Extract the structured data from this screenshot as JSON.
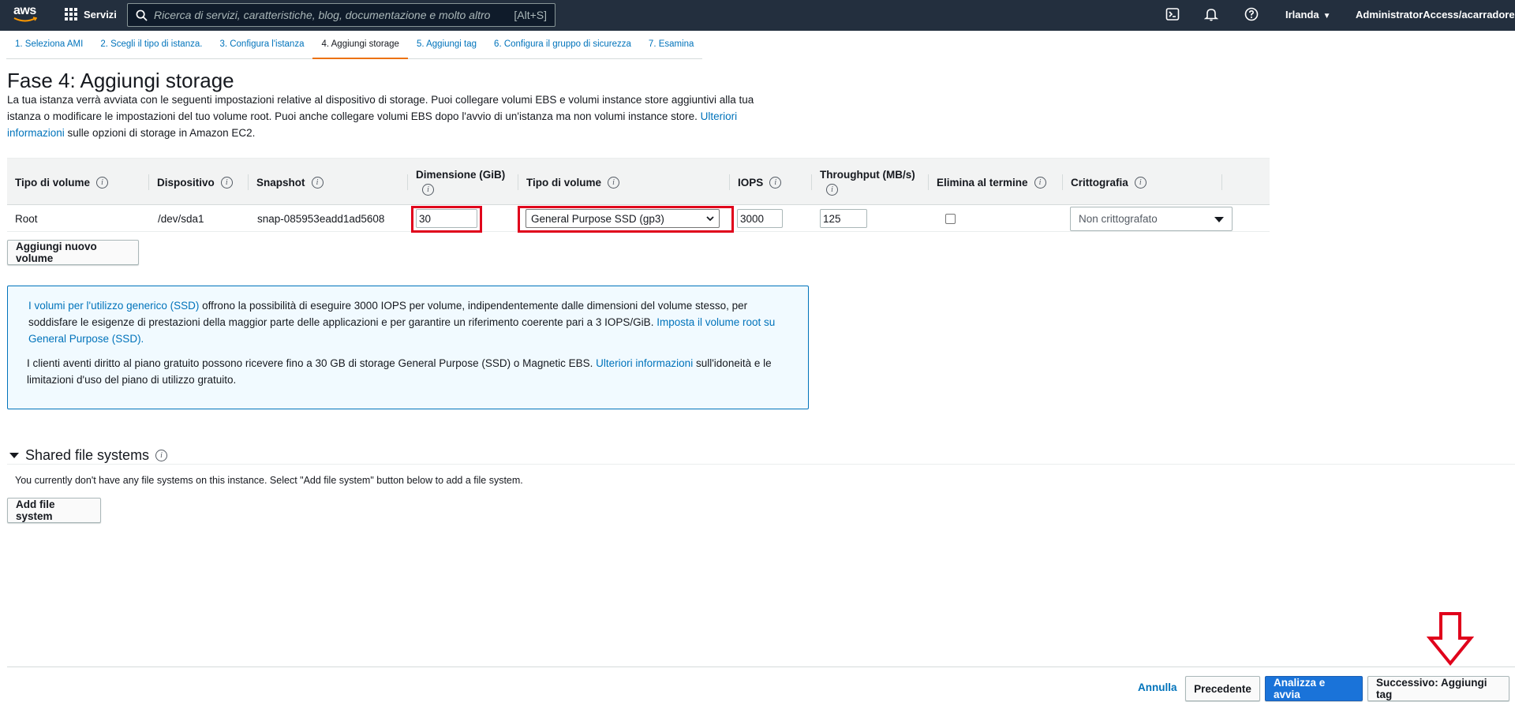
{
  "nav": {
    "logo": "aws",
    "services_label": "Servizi",
    "search_placeholder": "Ricerca di servizi, caratteristiche, blog, documentazione e molto altro",
    "search_shortcut": "[Alt+S]",
    "region": "Irlanda",
    "account": "AdministratorAccess/acarradore",
    "icons": [
      "cloudshell-icon",
      "bell-icon",
      "help-icon"
    ]
  },
  "steps": [
    {
      "label": "1. Seleziona AMI",
      "active": false
    },
    {
      "label": "2. Scegli il tipo di istanza.",
      "active": false
    },
    {
      "label": "3. Configura l'istanza",
      "active": false
    },
    {
      "label": "4. Aggiungi storage",
      "active": true
    },
    {
      "label": "5. Aggiungi tag",
      "active": false
    },
    {
      "label": "6. Configura il gruppo di sicurezza",
      "active": false
    },
    {
      "label": "7. Esamina",
      "active": false
    }
  ],
  "page": {
    "title": "Fase 4: Aggiungi storage",
    "desc_text": "La tua istanza verrà avviata con le seguenti impostazioni relative al dispositivo di storage. Puoi collegare volumi EBS e volumi instance store aggiuntivi alla tua istanza o modificare le impostazioni del tuo volume root. Puoi anche collegare volumi EBS dopo l'avvio di un'istanza ma non volumi instance store.",
    "desc_link": "Ulteriori informazioni",
    "desc_tail": "sulle opzioni di storage in Amazon EC2."
  },
  "table": {
    "headers": {
      "volume_type": "Tipo di volume",
      "device": "Dispositivo",
      "snapshot": "Snapshot",
      "size": "Dimensione (GiB)",
      "vol_type": "Tipo di volume",
      "iops": "IOPS",
      "throughput": "Throughput (MB/s)",
      "delete": "Elimina al termine",
      "encryption": "Crittografia"
    },
    "row": {
      "volume_type": "Root",
      "device": "/dev/sda1",
      "snapshot": "snap-085953eadd1ad5608",
      "size": "30",
      "vol_type": "General Purpose SSD (gp3)",
      "iops": "3000",
      "throughput": "125",
      "delete_checked": false,
      "encryption": "Non crittografato"
    },
    "add_volume_label": "Aggiungi nuovo volume"
  },
  "infobox": {
    "p1_link1": "I volumi per l'utilizzo generico (SSD)",
    "p1_text": "offrono la possibilità di eseguire 3000 IOPS per volume, indipendentemente dalle dimensioni del volume stesso, per soddisfare le esigenze di prestazioni della maggior parte delle applicazioni e per garantire un riferimento coerente pari a 3 IOPS/GiB.",
    "p1_link2": "Imposta il volume root su General Purpose (SSD).",
    "p2_text": "I clienti aventi diritto al piano gratuito possono ricevere fino a 30 GB di storage General Purpose (SSD) o Magnetic EBS.",
    "p2_link": "Ulteriori informazioni",
    "p2_tail": "sull'idoneità e le limitazioni d'uso del piano di utilizzo gratuito."
  },
  "shared_fs": {
    "title": "Shared file systems",
    "empty_text": "You currently don't have any file systems on this instance. Select \"Add file system\" button below to add a file system.",
    "add_label": "Add file system"
  },
  "footer": {
    "cancel": "Annulla",
    "previous": "Precedente",
    "review": "Analizza e avvia",
    "next": "Successivo: Aggiungi tag"
  },
  "colors": {
    "nav_bg": "#232f3e",
    "link": "#0073bb",
    "active_tab": "#ec7211",
    "highlight": "#e0001b",
    "primary_button": "#1a73d9"
  }
}
